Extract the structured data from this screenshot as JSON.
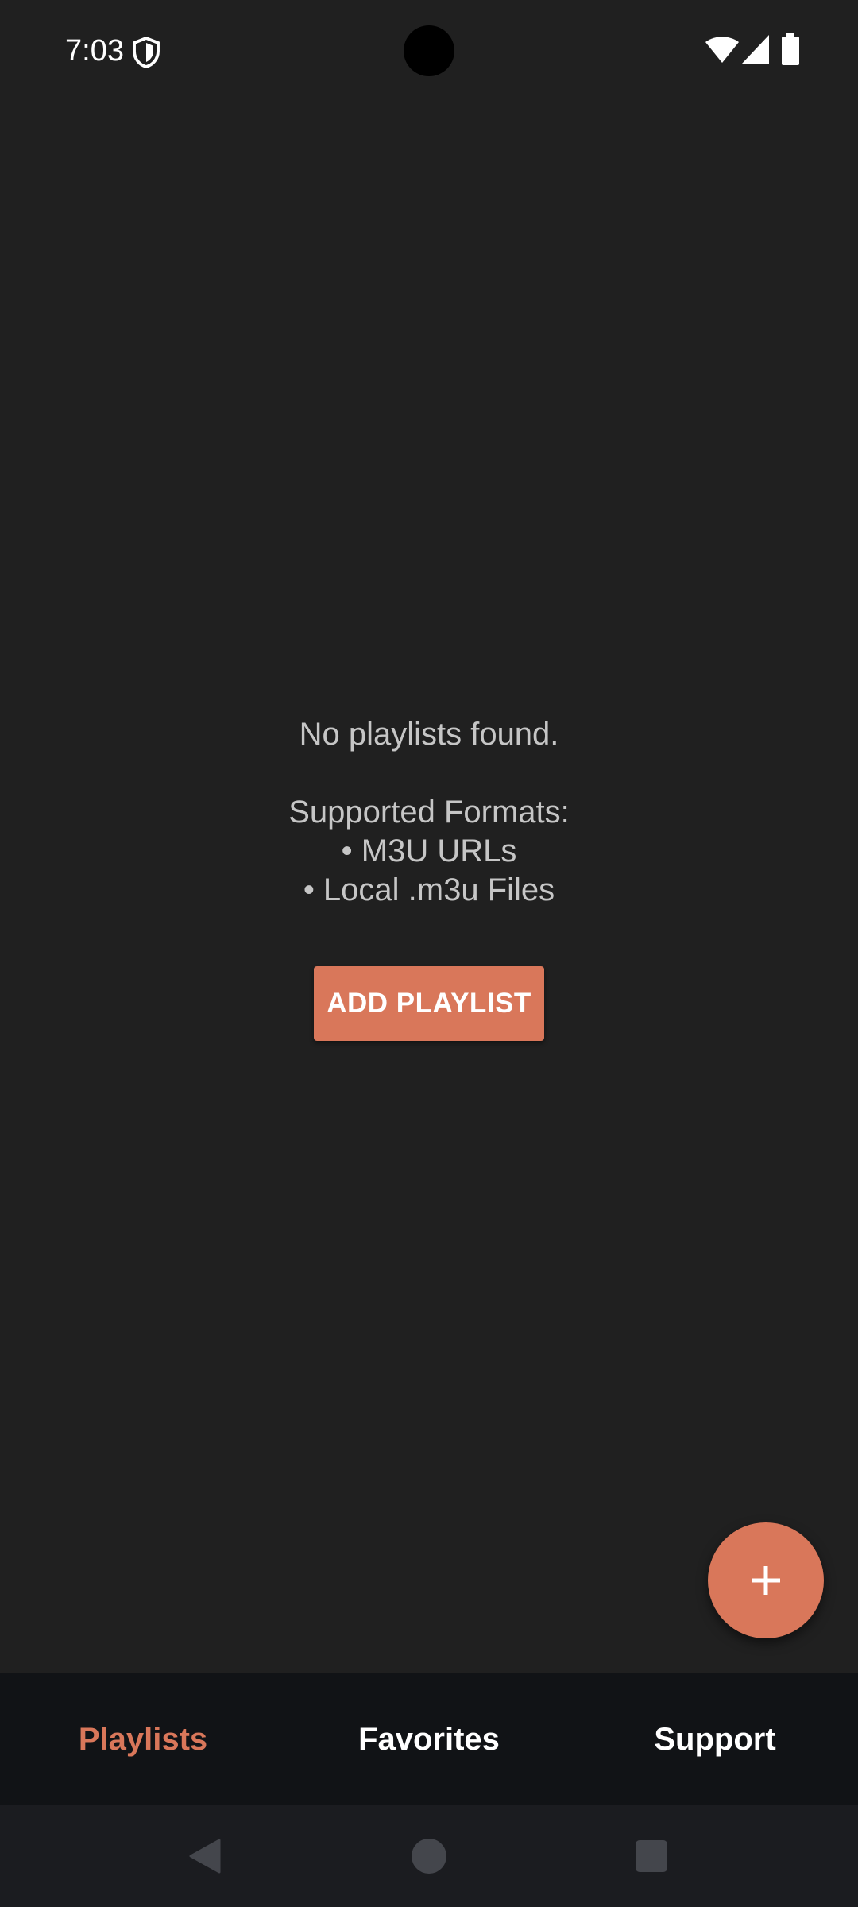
{
  "status_bar": {
    "time": "7:03",
    "icons": [
      "shield-icon",
      "wifi-icon",
      "signal-icon",
      "battery-icon"
    ]
  },
  "empty_state": {
    "title": "No playlists found.",
    "formats_heading": "Supported Formats:",
    "formats": [
      "• M3U URLs",
      "• Local .m3u Files"
    ]
  },
  "actions": {
    "add_playlist_label": "ADD PLAYLIST",
    "fab_icon": "plus-icon"
  },
  "bottom_nav": {
    "tabs": [
      {
        "label": "Playlists",
        "active": true
      },
      {
        "label": "Favorites",
        "active": false
      },
      {
        "label": "Support",
        "active": false
      }
    ]
  },
  "colors": {
    "background": "#202020",
    "accent": "#d9775a",
    "nav_background": "#111316",
    "text_muted": "#c6c6c6"
  }
}
